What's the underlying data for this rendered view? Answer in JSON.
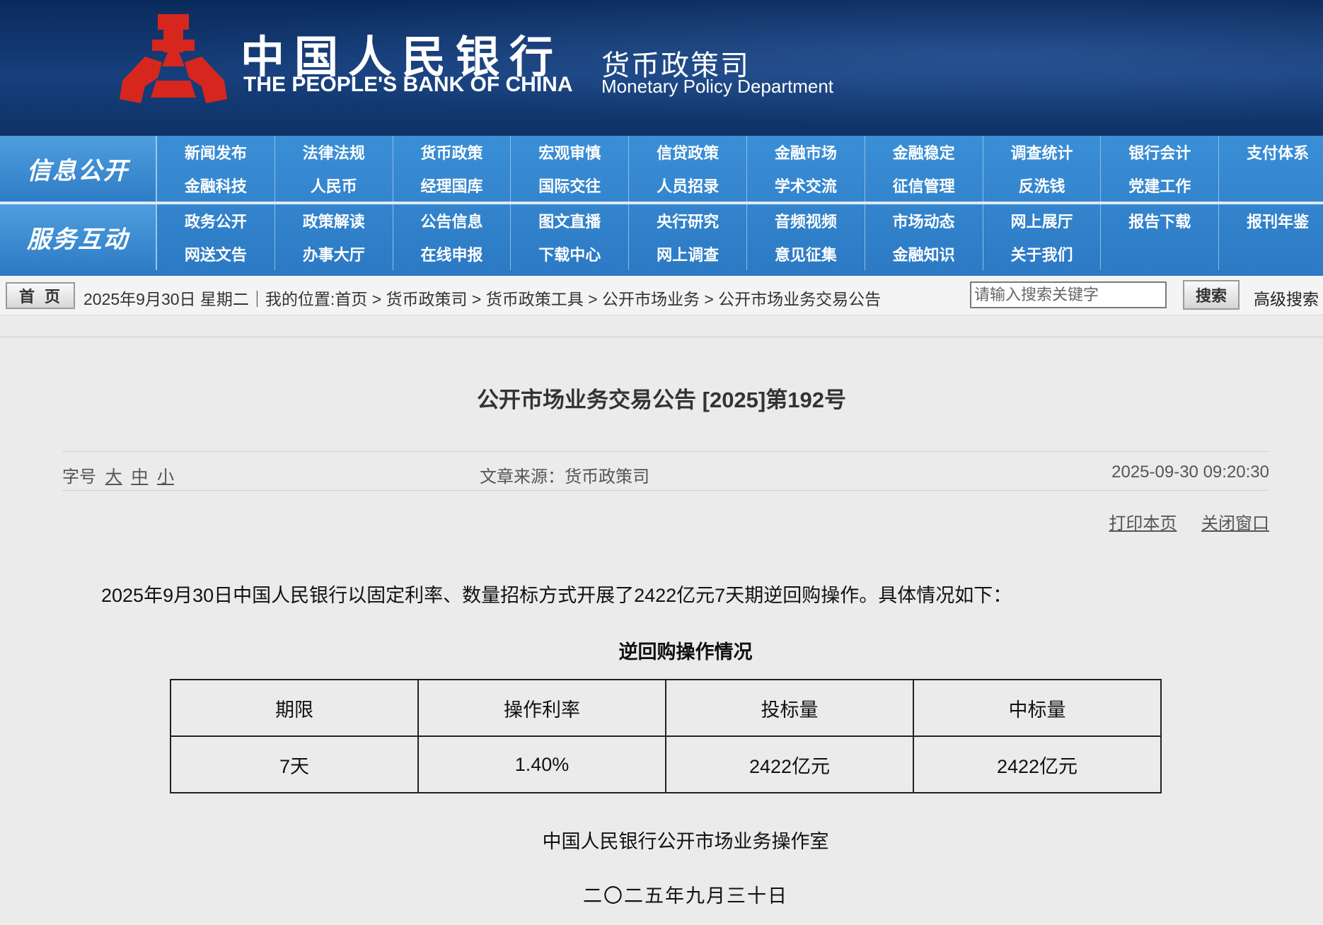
{
  "header": {
    "bank_name_cn": "中国人民银行",
    "bank_name_en": "THE PEOPLE'S BANK OF CHINA",
    "dept_name_cn": "货币政策司",
    "dept_name_en": "Monetary Policy Department",
    "logo_icon": "pboc-logo-icon",
    "logo_color": "#d7261e"
  },
  "nav": {
    "sections": [
      {
        "label": "信息公开",
        "items": [
          "新闻发布",
          "法律法规",
          "货币政策",
          "宏观审慎",
          "信贷政策",
          "金融市场",
          "金融稳定",
          "调查统计",
          "银行会计",
          "支付体系",
          "金融科技",
          "人民币",
          "经理国库",
          "国际交往",
          "人员招录",
          "学术交流",
          "征信管理",
          "反洗钱",
          "党建工作",
          ""
        ]
      },
      {
        "label": "服务互动",
        "items": [
          "政务公开",
          "政策解读",
          "公告信息",
          "图文直播",
          "央行研究",
          "音频视频",
          "市场动态",
          "网上展厅",
          "报告下载",
          "报刊年鉴",
          "网送文告",
          "办事大厅",
          "在线申报",
          "下载中心",
          "网上调查",
          "意见征集",
          "金融知识",
          "关于我们",
          "",
          ""
        ]
      }
    ]
  },
  "breadcrumb": {
    "home_label": "首页",
    "text": "2025年9月30日 星期二｜我的位置:首页 > 货币政策司 > 货币政策工具 > 公开市场业务 > 公开市场业务交易公告",
    "search_placeholder": "请输入搜索关键字",
    "search_button": "搜索",
    "advanced_search": "高级搜索"
  },
  "article": {
    "title": "公开市场业务交易公告 [2025]第192号",
    "font_size_label": "字号",
    "font_size_options": [
      "大",
      "中",
      "小"
    ],
    "source": "文章来源：货币政策司",
    "datetime": "2025-09-30 09:20:30",
    "print_label": "打印本页",
    "close_label": "关闭窗口",
    "intro": "2025年9月30日中国人民银行以固定利率、数量招标方式开展了2422亿元7天期逆回购操作。具体情况如下：",
    "table_title": "逆回购操作情况",
    "table": {
      "headers": [
        "期限",
        "操作利率",
        "投标量",
        "中标量"
      ],
      "rows": [
        [
          "7天",
          "1.40%",
          "2422亿元",
          "2422亿元"
        ]
      ]
    },
    "signature_org": "中国人民银行公开市场业务操作室",
    "signature_date": "二〇二五年九月三十日"
  }
}
